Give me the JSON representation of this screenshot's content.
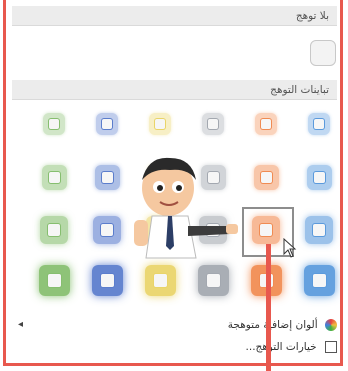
{
  "sections": {
    "no_glow": {
      "title": "بلا توهج"
    },
    "glow_variants": {
      "title": "تباينات التوهج"
    }
  },
  "colors": {
    "frame": "#e8584e",
    "glow_row_colors": [
      "#4a90d9",
      "#f08040",
      "#9aa0a8",
      "#e8d05a",
      "#4a70c8",
      "#7ab860"
    ]
  },
  "footer": {
    "more_colors_label": "ألوان إضافية متوهجة",
    "options_label": "خيارات التوهج...",
    "palette_icon": "palette-icon",
    "checkbox_icon": "checkbox-icon",
    "left_arrow_icon": "left-arrow-icon",
    "grip": "....."
  },
  "overlay": {
    "character": "cartoon-presenter-pointing",
    "hovered_cell": "row-3-col-2"
  }
}
